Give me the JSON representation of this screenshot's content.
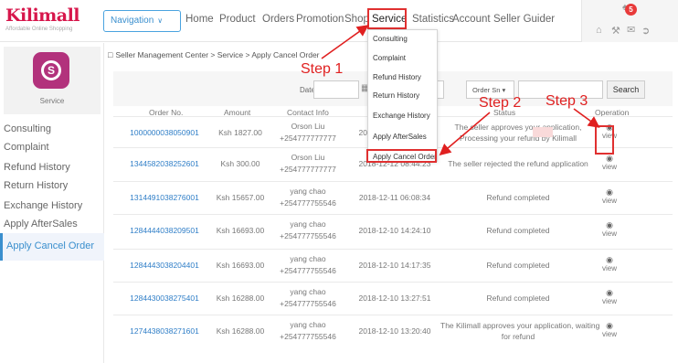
{
  "header": {
    "logo_name": "Kilimall",
    "logo_tagline": "Affordable Online Shopping",
    "nav_button": "Navigation",
    "menu": [
      "Home",
      "Product",
      "Orders",
      "Promotion",
      "Shop",
      "Service",
      "Statistics",
      "Account",
      "Seller Guider"
    ],
    "notification_count": "5",
    "icons": [
      "user-icon",
      "home-icon",
      "wrench-icon",
      "message-icon",
      "logout-icon"
    ]
  },
  "dropdown": {
    "items": [
      "Consulting",
      "Complaint",
      "Refund History",
      "Return History",
      "Exchange History",
      "Apply AfterSales",
      "Apply Cancel Order"
    ]
  },
  "sidebar": {
    "card_label": "Service",
    "items": [
      "Consulting",
      "Complaint",
      "Refund History",
      "Return History",
      "Exchange History",
      "Apply AfterSales"
    ],
    "active_item": "Apply Cancel Order"
  },
  "breadcrumb": {
    "items": [
      "Seller Management Center",
      "Service",
      "Apply Cancel Order"
    ],
    "separator": ">"
  },
  "filters": {
    "date_label": "Date",
    "order_select": "Order Sn",
    "search_button": "Search"
  },
  "table": {
    "headers": [
      "Order No.",
      "Amount",
      "Contact Info",
      "",
      "Status",
      "Operation"
    ],
    "view_label": "view",
    "rows": [
      {
        "order_no": "1000000038050901",
        "amount": "Ksh 1827.00",
        "contact_name": "Orson Liu",
        "contact_phone": "+254777777777",
        "date": "2018-12-12 09:27:06",
        "status1": "The seller approves your application,",
        "status2": "Processing your refund by Kilimall"
      },
      {
        "order_no": "1344582038252601",
        "amount": "Ksh 300.00",
        "contact_name": "Orson Liu",
        "contact_phone": "+254777777777",
        "date": "2018-12-12 08:44:23",
        "status1": "The seller rejected the refund application",
        "status2": ""
      },
      {
        "order_no": "1314491038276001",
        "amount": "Ksh 15657.00",
        "contact_name": "yang chao",
        "contact_phone": "+254777755546",
        "date": "2018-12-11 06:08:34",
        "status1": "Refund completed",
        "status2": ""
      },
      {
        "order_no": "1284444038209501",
        "amount": "Ksh 16693.00",
        "contact_name": "yang chao",
        "contact_phone": "+254777755546",
        "date": "2018-12-10 14:24:10",
        "status1": "Refund completed",
        "status2": ""
      },
      {
        "order_no": "1284443038204401",
        "amount": "Ksh 16693.00",
        "contact_name": "yang chao",
        "contact_phone": "+254777755546",
        "date": "2018-12-10 14:17:35",
        "status1": "Refund completed",
        "status2": ""
      },
      {
        "order_no": "1284430038275401",
        "amount": "Ksh 16288.00",
        "contact_name": "yang chao",
        "contact_phone": "+254777755546",
        "date": "2018-12-10 13:27:51",
        "status1": "Refund completed",
        "status2": ""
      },
      {
        "order_no": "1274438038271601",
        "amount": "Ksh 16288.00",
        "contact_name": "yang chao",
        "contact_phone": "+254777755546",
        "date": "2018-12-10 13:20:40",
        "status1": "The Kilimall approves your application, waiting",
        "status2": "for refund"
      }
    ]
  },
  "annotations": {
    "step1": "Step 1",
    "step2": "Step 2",
    "step3": "Step 3",
    "color": "#e02020"
  }
}
